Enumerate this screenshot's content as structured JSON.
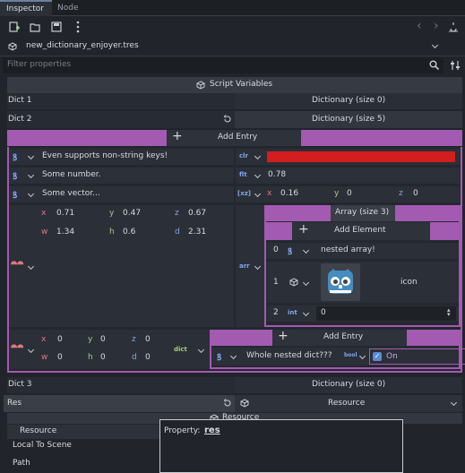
{
  "tabs": [
    {
      "label": "Inspector",
      "active": true
    },
    {
      "label": "Node",
      "active": false
    }
  ],
  "toolbar": {
    "icons": [
      "new-resource-icon",
      "open-folder-icon",
      "save-icon",
      "kebab-menu-icon"
    ],
    "back": "‹",
    "forward": "›"
  },
  "resource": {
    "name": "new_dictionary_enjoyer.tres"
  },
  "filter": {
    "placeholder": "Filter properties"
  },
  "section": {
    "title": "Script Variables"
  },
  "dict1": {
    "label": "Dict 1",
    "value": "Dictionary (size 0)"
  },
  "dict2": {
    "label": "Dict 2",
    "value": "Dictionary (size 5)",
    "add_entry": "Add Entry",
    "entries": [
      {
        "key": "Even supports non-string keys!",
        "value_color": "#d21e1e"
      },
      {
        "key": "Some number.",
        "value": "0.78"
      },
      {
        "key": "Some vector...",
        "x": "0.16",
        "y": "0",
        "z": "0"
      }
    ],
    "aabb_key": {
      "x": "0.71",
      "y": "0.47",
      "z": "0.67",
      "w": "1.34",
      "h": "0.6",
      "d": "2.31"
    },
    "array": {
      "title": "Array (size 3)",
      "add_element": "Add Element",
      "items": [
        {
          "index": "0",
          "value": "nested array!"
        },
        {
          "index": "1",
          "value": "icon"
        },
        {
          "index": "2",
          "type": "int",
          "value": "0"
        }
      ]
    },
    "aabb2_key": {
      "x": "0",
      "y": "0",
      "z": "0",
      "w": "0",
      "h": "0",
      "d": "0"
    },
    "nested": {
      "add_entry": "Add Entry",
      "key": "Whole nested dict???",
      "bool_label": "On"
    }
  },
  "dict3": {
    "label": "Dict 3",
    "value": "Dictionary (size 0)"
  },
  "res": {
    "label": "Res",
    "value": "Resource",
    "sub_header": "Resource",
    "resource_label": "Resource",
    "local": "Local To Scene",
    "path": "Path"
  },
  "tooltip": {
    "prefix": "Property:",
    "name": "res"
  },
  "type_icons": {
    "string": "ꝸ",
    "float": "flt",
    "vector": "[xz]",
    "array": "arr",
    "dict": "dict",
    "int": "int",
    "color": "clr",
    "aabb": "▣",
    "bool": "bool"
  },
  "colors": {
    "accent_purple": "#a35ab1",
    "value_red": "#d21e1e"
  }
}
